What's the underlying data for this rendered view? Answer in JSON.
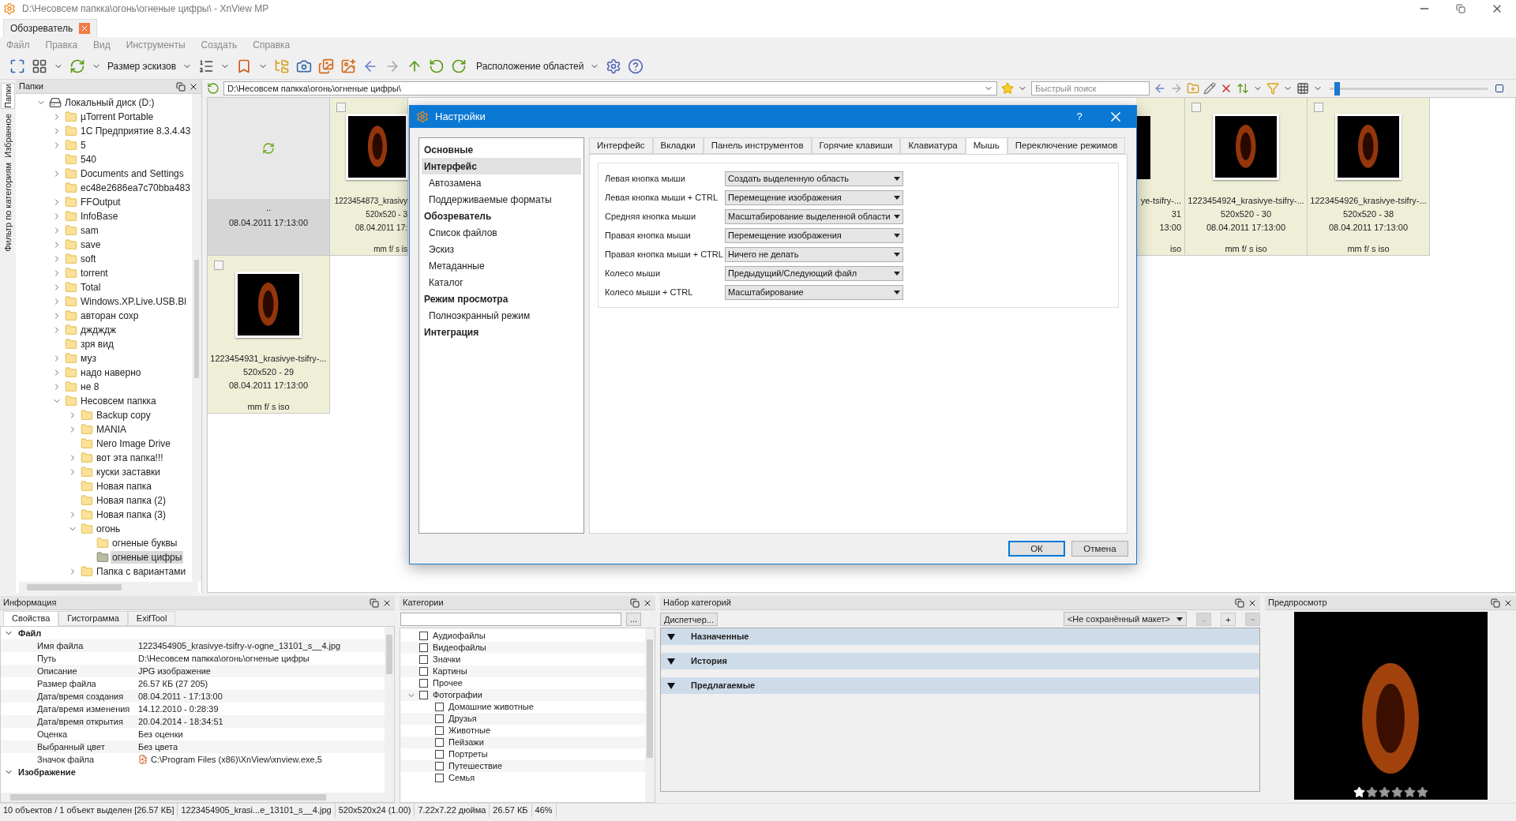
{
  "window": {
    "title": "D:\\Несовсем папкка\\огонь\\огненые цифры\\ - XnView MP"
  },
  "doc_tabs": [
    {
      "label": "Обозреватель",
      "selected": true
    }
  ],
  "menu": [
    "Файл",
    "Правка",
    "Вид",
    "Инструменты",
    "Создать",
    "Справка"
  ],
  "toolbar": {
    "thumb_size_label": "Размер эскизов",
    "layout_label": "Расположение областей"
  },
  "side_tabs": [
    {
      "label": "Папки",
      "selected": true
    },
    {
      "label": "Избранное",
      "selected": false
    },
    {
      "label": "Фильтр по категориям",
      "selected": false
    }
  ],
  "folders_panel": {
    "title": "Папки",
    "tree": [
      {
        "label": "Локальный диск (D:)",
        "kind": "drive",
        "expanded": true,
        "selected": false,
        "children": [
          {
            "label": "µTorrent Portable",
            "kind": "folder",
            "expanded": false,
            "selected": false
          },
          {
            "label": "1С Предприятие 8.3.4.43",
            "kind": "folder",
            "expanded": false,
            "selected": false
          },
          {
            "label": "5",
            "kind": "folder",
            "expanded": false,
            "selected": false
          },
          {
            "label": "540",
            "kind": "folder",
            "selected": false
          },
          {
            "label": "Documents and Settings",
            "kind": "folder",
            "expanded": false,
            "selected": false
          },
          {
            "label": "ec48e2686ea7c70bba483",
            "kind": "folder",
            "selected": false
          },
          {
            "label": "FFOutput",
            "kind": "folder",
            "expanded": false,
            "selected": false
          },
          {
            "label": "InfoBase",
            "kind": "folder",
            "expanded": false,
            "selected": false
          },
          {
            "label": "sam",
            "kind": "folder",
            "expanded": false,
            "selected": false
          },
          {
            "label": "save",
            "kind": "folder",
            "expanded": false,
            "selected": false
          },
          {
            "label": "soft",
            "kind": "folder",
            "expanded": false,
            "selected": false
          },
          {
            "label": "torrent",
            "kind": "folder",
            "expanded": false,
            "selected": false
          },
          {
            "label": "Total",
            "kind": "folder",
            "expanded": false,
            "selected": false
          },
          {
            "label": "Windows.XP.Live.USB.Bl",
            "kind": "folder",
            "expanded": false,
            "selected": false
          },
          {
            "label": "авторан сохр",
            "kind": "folder",
            "expanded": false,
            "selected": false
          },
          {
            "label": "дждждж",
            "kind": "folder",
            "expanded": false,
            "selected": false
          },
          {
            "label": "зря вид",
            "kind": "folder",
            "selected": false
          },
          {
            "label": "муз",
            "kind": "folder",
            "expanded": false,
            "selected": false
          },
          {
            "label": "надо наверно",
            "kind": "folder",
            "expanded": false,
            "selected": false
          },
          {
            "label": "не 8",
            "kind": "folder",
            "expanded": false,
            "selected": false
          },
          {
            "label": "Несовсем папкка",
            "kind": "folder",
            "expanded": true,
            "selected": false,
            "children": [
              {
                "label": "Backup copy",
                "kind": "folder",
                "expanded": false,
                "selected": false
              },
              {
                "label": "MANIA",
                "kind": "folder",
                "expanded": false,
                "selected": false
              },
              {
                "label": "Nero Image Drive",
                "kind": "folder",
                "selected": false
              },
              {
                "label": "вот эта папка!!!",
                "kind": "folder",
                "expanded": false,
                "selected": false
              },
              {
                "label": "куски заставки",
                "kind": "folder",
                "expanded": false,
                "selected": false
              },
              {
                "label": "Новая папка",
                "kind": "folder",
                "selected": false
              },
              {
                "label": "Новая папка (2)",
                "kind": "folder",
                "selected": false
              },
              {
                "label": "Новая папка (3)",
                "kind": "folder",
                "expanded": false,
                "selected": false
              },
              {
                "label": "огонь",
                "kind": "folder",
                "expanded": true,
                "selected": false,
                "children": [
                  {
                    "label": "огненые буквы",
                    "kind": "folder",
                    "selected": false
                  },
                  {
                    "label": "огненые цифры",
                    "kind": "folder",
                    "selected": true
                  }
                ]
              },
              {
                "label": "Папка с вариантами",
                "kind": "folder",
                "expanded": false,
                "selected": false
              }
            ]
          }
        ]
      }
    ]
  },
  "path_bar": {
    "path": "D:\\Несовсем папкка\\огонь\\огненые цифры\\",
    "search_placeholder": "Быстрый поиск",
    "zoom_slider": {
      "level": 0.03
    }
  },
  "thumbnails": {
    "rows": [
      [
        {
          "kind": "parent",
          "name": "..",
          "date": "08.04.2011 17:13:00"
        },
        {
          "kind": "clipped_right",
          "name": "1223454873_krasivy",
          "size": "520x520 - 3",
          "date": "08.04.2011 17:",
          "exif": "mm f/ s is",
          "checked": false
        },
        {
          "kind": "clipped_left",
          "name": "ye-tsifry-...",
          "size": "31",
          "date": "13:00",
          "exif": "iso"
        },
        {
          "kind": "image",
          "name": "1223454924_krasivye-tsifry-...",
          "size": "520x520 - 30",
          "date": "08.04.2011 17:13:00",
          "exif": "mm f/ s iso",
          "checked": false
        },
        {
          "kind": "image",
          "name": "1223454926_krasivye-tsifry-...",
          "size": "520x520 - 38",
          "date": "08.04.2011 17:13:00",
          "exif": "mm f/ s iso",
          "checked": false
        }
      ],
      [
        {
          "kind": "image",
          "name": "1223454931_krasivye-tsifry-...",
          "size": "520x520 - 29",
          "date": "08.04.2011 17:13:00",
          "exif": "mm f/ s iso",
          "checked": false
        }
      ]
    ]
  },
  "settings_dialog": {
    "title": "Настройки",
    "help": "?",
    "nav": [
      {
        "label": "Основные",
        "kind": "section",
        "selected": false
      },
      {
        "label": "Интерфейс",
        "kind": "section",
        "selected": true
      },
      {
        "label": "Автозамена",
        "kind": "page",
        "selected": false
      },
      {
        "label": "Поддерживаемые форматы",
        "kind": "page",
        "selected": false
      },
      {
        "label": "Обозреватель",
        "kind": "section",
        "selected": false
      },
      {
        "label": "Список файлов",
        "kind": "page",
        "selected": false
      },
      {
        "label": "Эскиз",
        "kind": "page",
        "selected": false
      },
      {
        "label": "Метаданные",
        "kind": "page",
        "selected": false
      },
      {
        "label": "Каталог",
        "kind": "page",
        "selected": false
      },
      {
        "label": "Режим просмотра",
        "kind": "section",
        "selected": false
      },
      {
        "label": "Полноэкранный режим",
        "kind": "page",
        "selected": false
      },
      {
        "label": "Интеграция",
        "kind": "section",
        "selected": false
      }
    ],
    "tabs": [
      {
        "label": "Интерфейс",
        "selected": false
      },
      {
        "label": "Вкладки",
        "selected": false
      },
      {
        "label": "Панель инструментов",
        "selected": false
      },
      {
        "label": "Горячие клавиши",
        "selected": false
      },
      {
        "label": "Клавиатура",
        "selected": false
      },
      {
        "label": "Мышь",
        "selected": true
      },
      {
        "label": "Переключение режимов",
        "selected": false
      }
    ],
    "mouse_settings": [
      {
        "label": "Левая кнопка мыши",
        "value": "Создать выделенную область"
      },
      {
        "label": "Левая кнопка мыши + CTRL",
        "value": "Перемещение изображения"
      },
      {
        "label": "Средняя кнопка мыши",
        "value": "Масштабирование выделенной области"
      },
      {
        "label": "Правая кнопка мыши",
        "value": "Перемещение изображения"
      },
      {
        "label": "Правая кнопка мыши + CTRL",
        "value": "Ничего не делать"
      },
      {
        "label": "Колесо мыши",
        "value": "Предыдущий/Следующий файл"
      },
      {
        "label": "Колесо мыши + CTRL",
        "value": "Масштабирование"
      }
    ],
    "buttons": [
      {
        "label": "ОК",
        "kind": "default"
      },
      {
        "label": "Отмена",
        "kind": "normal"
      }
    ]
  },
  "info_panel": {
    "title": "Информация",
    "tabs": [
      {
        "label": "Свойства",
        "selected": true
      },
      {
        "label": "Гистограмма",
        "selected": false
      },
      {
        "label": "ExifTool",
        "selected": false
      }
    ],
    "groups": [
      {
        "label": "Файл",
        "expanded": true,
        "rows": [
          {
            "name": "Имя файла",
            "value": "1223454905_krasivye-tsifry-v-ogne_13101_s__4.jpg"
          },
          {
            "name": "Путь",
            "value": "D:\\Несовсем папкка\\огонь\\огненые цифры"
          },
          {
            "name": "Описание",
            "value": "JPG изображение"
          },
          {
            "name": "Размер файла",
            "value": "26.57 КБ (27 205)"
          },
          {
            "name": "Дата/время создания",
            "value": "08.04.2011 - 17:13:00"
          },
          {
            "name": "Дата/время изменения",
            "value": "14.12.2010 - 0:28:39"
          },
          {
            "name": "Дата/время открытия",
            "value": "20.04.2014 - 18:34:51"
          },
          {
            "name": "Оценка",
            "value": "Без оценки"
          },
          {
            "name": "Выбранный цвет",
            "value": "Без цвета"
          },
          {
            "name": "Значок файла",
            "value": "C:\\Program Files (x86)\\XnView\\xnview.exe,5",
            "kind": "icon"
          }
        ]
      },
      {
        "label": "Изображение",
        "expanded": true
      }
    ]
  },
  "categories_panel": {
    "title": "Категории",
    "more": "...",
    "items": [
      {
        "label": "Аудиофайлы",
        "checked": false
      },
      {
        "label": "Видеофайлы",
        "checked": false
      },
      {
        "label": "Значки",
        "checked": false
      },
      {
        "label": "Картины",
        "checked": false
      },
      {
        "label": "Прочее",
        "checked": false
      },
      {
        "label": "Фотографии",
        "checked": false,
        "expanded": true,
        "children": [
          {
            "label": "Домашние животные",
            "checked": false
          },
          {
            "label": "Друзья",
            "checked": false
          },
          {
            "label": "Животные",
            "checked": false
          },
          {
            "label": "Пейзажи",
            "checked": false
          },
          {
            "label": "Портреты",
            "checked": false
          },
          {
            "label": "Путешествие",
            "checked": false
          },
          {
            "label": "Семья",
            "checked": false
          }
        ]
      }
    ]
  },
  "category_sets_panel": {
    "title": "Набор категорий",
    "manager_button": "Диспетчер...",
    "layout": "<Не сохранённый макет>",
    "small_buttons": [
      "-",
      "+",
      "~"
    ],
    "sections": [
      {
        "label": "Назначенные",
        "expanded": true
      },
      {
        "label": "История",
        "expanded": true
      },
      {
        "label": "Предлагаемые",
        "expanded": true
      }
    ]
  },
  "preview_panel": {
    "title": "Предпросмотр",
    "stars": 1
  },
  "status_bar": [
    "10 объектов / 1 объект выделен [26.57 КБ]",
    "1223454905_krasi...e_13101_s__4.jpg",
    "520x520x24 (1.00)",
    "7.22x7.22 дюйма",
    "26.57 КБ",
    "46%"
  ]
}
